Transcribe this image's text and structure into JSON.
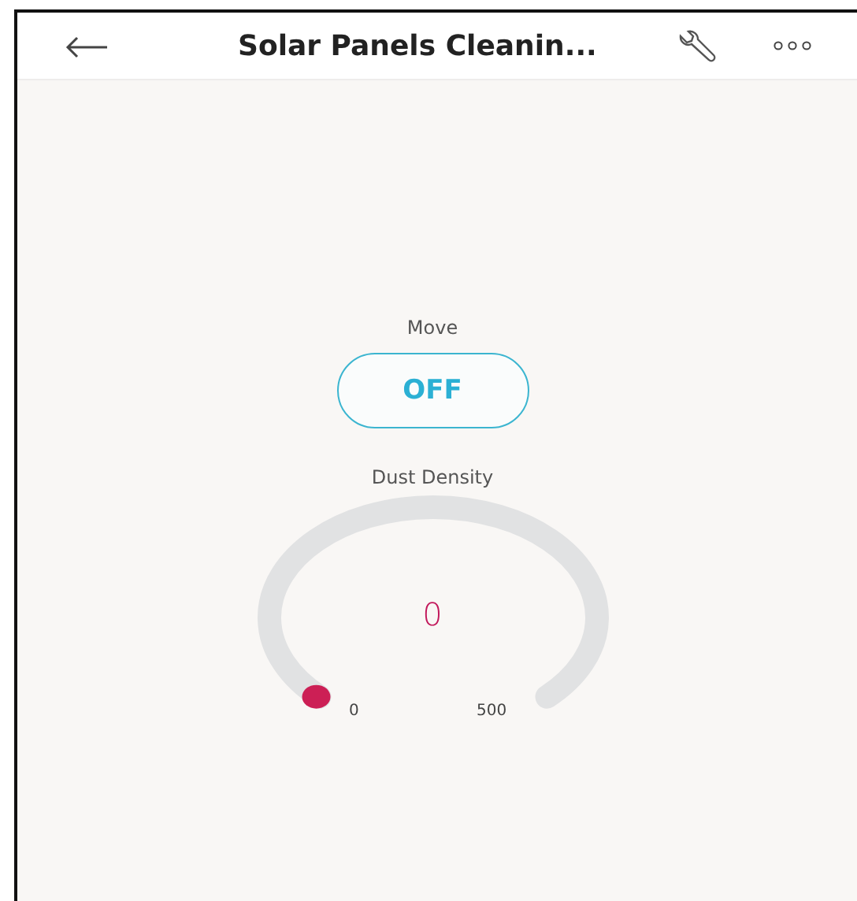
{
  "header": {
    "title": "Solar Panels Cleanin..."
  },
  "switch": {
    "label": "Move",
    "text": "OFF",
    "on": false
  },
  "gauge": {
    "label": "Dust Density",
    "value": "0",
    "min": "0",
    "max": "500"
  }
}
